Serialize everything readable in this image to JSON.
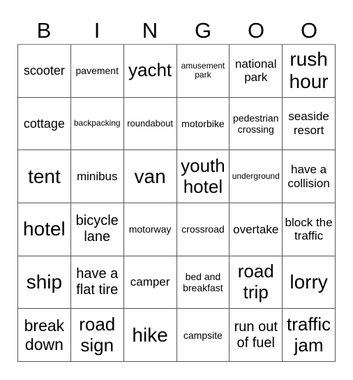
{
  "header": [
    "B",
    "I",
    "N",
    "G",
    "O",
    "O"
  ],
  "cells": [
    [
      "scooter",
      "pavement",
      "yacht",
      "amusement park",
      "national park",
      "rush hour"
    ],
    [
      "cottage",
      "backpacking",
      "roundabout",
      "motorbike",
      "pedestrian crossing",
      "seaside resort"
    ],
    [
      "tent",
      "minibus",
      "van",
      "youth hotel",
      "underground",
      "have a collision"
    ],
    [
      "hotel",
      "bicycle lane",
      "motorway",
      "crossroad",
      "overtake",
      "block the traffic"
    ],
    [
      "ship",
      "have a flat tire",
      "camper",
      "bed and breakfast",
      "road trip",
      "lorry"
    ],
    [
      "break down",
      "road sign",
      "hike",
      "campsite",
      "run out of fuel",
      "traffic jam"
    ]
  ]
}
